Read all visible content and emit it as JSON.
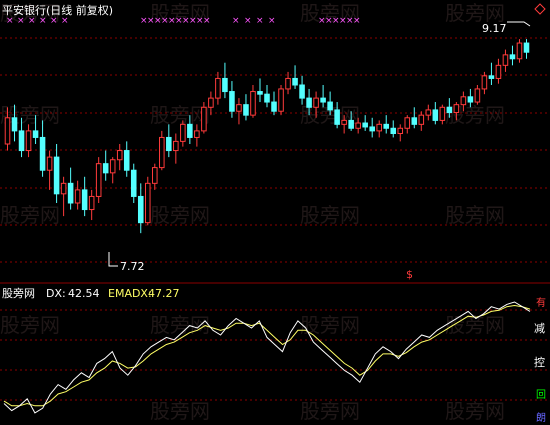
{
  "colors": {
    "background": "#000000",
    "up": "#ff3b3b",
    "down": "#54ffff",
    "grid": "#8b0000",
    "marker_x": "#ff55ff",
    "title": "#ffffff",
    "dx_line": "#ffffff",
    "emadx_line": "#ffff66",
    "ind_label_green": "#00ff00",
    "ind_label_blue": "#6666ff"
  },
  "header": {
    "title": "平安银行(日线 前复权)",
    "watermark": "股旁网",
    "diamond_icon": "diamond-icon"
  },
  "price_panel": {
    "high_label": "9.17",
    "low_label": "7.72",
    "dollar_marker": "$"
  },
  "indicator_panel": {
    "name": "股旁网",
    "dx_label": "DX:",
    "dx_value": "42.54",
    "emadx_label": "EMADX:",
    "emadx_value": "47.27",
    "right_labels": [
      "有",
      "减",
      "控",
      "回",
      "朗"
    ]
  },
  "chart_data": {
    "type": "candlestick",
    "price_ylim": [
      7.5,
      9.3
    ],
    "candles": [
      [
        8.4,
        8.68,
        8.35,
        8.6
      ],
      [
        8.6,
        8.7,
        8.42,
        8.5
      ],
      [
        8.5,
        8.6,
        8.3,
        8.35
      ],
      [
        8.35,
        8.55,
        8.3,
        8.5
      ],
      [
        8.5,
        8.62,
        8.4,
        8.45
      ],
      [
        8.45,
        8.58,
        8.15,
        8.2
      ],
      [
        8.2,
        8.35,
        8.05,
        8.3
      ],
      [
        8.3,
        8.4,
        7.95,
        8.02
      ],
      [
        8.02,
        8.15,
        7.85,
        8.1
      ],
      [
        8.1,
        8.22,
        7.9,
        7.95
      ],
      [
        7.95,
        8.12,
        7.9,
        8.05
      ],
      [
        8.05,
        8.15,
        7.85,
        7.9
      ],
      [
        7.9,
        8.05,
        7.82,
        8.0
      ],
      [
        8.0,
        8.3,
        7.95,
        8.25
      ],
      [
        8.25,
        8.35,
        8.12,
        8.18
      ],
      [
        8.18,
        8.3,
        8.1,
        8.28
      ],
      [
        8.28,
        8.4,
        8.2,
        8.35
      ],
      [
        8.35,
        8.42,
        8.15,
        8.2
      ],
      [
        8.2,
        8.25,
        7.95,
        8.0
      ],
      [
        8.0,
        8.1,
        7.72,
        7.8
      ],
      [
        7.8,
        8.15,
        7.78,
        8.1
      ],
      [
        8.1,
        8.25,
        8.05,
        8.22
      ],
      [
        8.22,
        8.5,
        8.2,
        8.45
      ],
      [
        8.45,
        8.55,
        8.3,
        8.35
      ],
      [
        8.35,
        8.48,
        8.25,
        8.42
      ],
      [
        8.42,
        8.58,
        8.38,
        8.55
      ],
      [
        8.55,
        8.62,
        8.4,
        8.45
      ],
      [
        8.45,
        8.55,
        8.38,
        8.5
      ],
      [
        8.5,
        8.72,
        8.48,
        8.68
      ],
      [
        8.68,
        8.8,
        8.62,
        8.75
      ],
      [
        8.75,
        8.95,
        8.7,
        8.9
      ],
      [
        8.9,
        9.02,
        8.75,
        8.8
      ],
      [
        8.8,
        8.88,
        8.6,
        8.65
      ],
      [
        8.65,
        8.75,
        8.55,
        8.7
      ],
      [
        8.7,
        8.78,
        8.58,
        8.62
      ],
      [
        8.62,
        8.85,
        8.6,
        8.8
      ],
      [
        8.8,
        8.9,
        8.72,
        8.78
      ],
      [
        8.78,
        8.85,
        8.68,
        8.72
      ],
      [
        8.72,
        8.8,
        8.62,
        8.65
      ],
      [
        8.65,
        8.85,
        8.62,
        8.82
      ],
      [
        8.82,
        8.95,
        8.78,
        8.9
      ],
      [
        8.9,
        9.0,
        8.82,
        8.85
      ],
      [
        8.85,
        8.92,
        8.7,
        8.75
      ],
      [
        8.75,
        8.82,
        8.62,
        8.68
      ],
      [
        8.68,
        8.8,
        8.6,
        8.75
      ],
      [
        8.75,
        8.85,
        8.68,
        8.72
      ],
      [
        8.72,
        8.8,
        8.62,
        8.66
      ],
      [
        8.66,
        8.72,
        8.52,
        8.55
      ],
      [
        8.55,
        8.62,
        8.48,
        8.58
      ],
      [
        8.58,
        8.65,
        8.5,
        8.52
      ],
      [
        8.52,
        8.6,
        8.48,
        8.56
      ],
      [
        8.56,
        8.62,
        8.5,
        8.53
      ],
      [
        8.53,
        8.6,
        8.45,
        8.5
      ],
      [
        8.5,
        8.58,
        8.45,
        8.55
      ],
      [
        8.55,
        8.62,
        8.48,
        8.52
      ],
      [
        8.52,
        8.58,
        8.45,
        8.48
      ],
      [
        8.48,
        8.55,
        8.42,
        8.52
      ],
      [
        8.52,
        8.62,
        8.48,
        8.6
      ],
      [
        8.6,
        8.68,
        8.52,
        8.55
      ],
      [
        8.55,
        8.65,
        8.5,
        8.62
      ],
      [
        8.62,
        8.7,
        8.58,
        8.66
      ],
      [
        8.66,
        8.72,
        8.55,
        8.58
      ],
      [
        8.58,
        8.7,
        8.55,
        8.68
      ],
      [
        8.68,
        8.75,
        8.6,
        8.64
      ],
      [
        8.64,
        8.72,
        8.58,
        8.7
      ],
      [
        8.7,
        8.8,
        8.65,
        8.76
      ],
      [
        8.76,
        8.82,
        8.68,
        8.72
      ],
      [
        8.72,
        8.85,
        8.7,
        8.82
      ],
      [
        8.82,
        8.95,
        8.78,
        8.92
      ],
      [
        8.92,
        9.02,
        8.85,
        8.9
      ],
      [
        8.9,
        9.05,
        8.86,
        9.0
      ],
      [
        9.0,
        9.12,
        8.95,
        9.08
      ],
      [
        9.08,
        9.15,
        9.0,
        9.05
      ],
      [
        9.05,
        9.2,
        9.02,
        9.17
      ],
      [
        9.17,
        9.2,
        9.05,
        9.1
      ]
    ],
    "dx_series": [
      14,
      8,
      12,
      18,
      6,
      10,
      22,
      30,
      26,
      34,
      40,
      36,
      48,
      52,
      58,
      44,
      38,
      46,
      56,
      62,
      66,
      70,
      68,
      74,
      80,
      78,
      84,
      76,
      72,
      80,
      86,
      82,
      78,
      84,
      70,
      64,
      58,
      74,
      84,
      78,
      66,
      60,
      54,
      48,
      42,
      38,
      32,
      44,
      56,
      62,
      58,
      52,
      60,
      66,
      72,
      70,
      76,
      80,
      84,
      88,
      92,
      86,
      90,
      96,
      94,
      98,
      100,
      96,
      92
    ],
    "emadx_series": [
      16,
      12,
      12,
      14,
      12,
      12,
      16,
      22,
      24,
      28,
      32,
      34,
      40,
      44,
      50,
      48,
      44,
      45,
      50,
      56,
      60,
      64,
      66,
      70,
      74,
      76,
      80,
      78,
      76,
      78,
      82,
      82,
      80,
      82,
      76,
      70,
      64,
      68,
      76,
      76,
      72,
      66,
      60,
      54,
      48,
      44,
      38,
      42,
      50,
      56,
      56,
      54,
      57,
      62,
      66,
      68,
      72,
      76,
      80,
      84,
      88,
      87,
      89,
      92,
      93,
      96,
      97,
      96,
      94
    ],
    "x_markers_count": 26
  }
}
